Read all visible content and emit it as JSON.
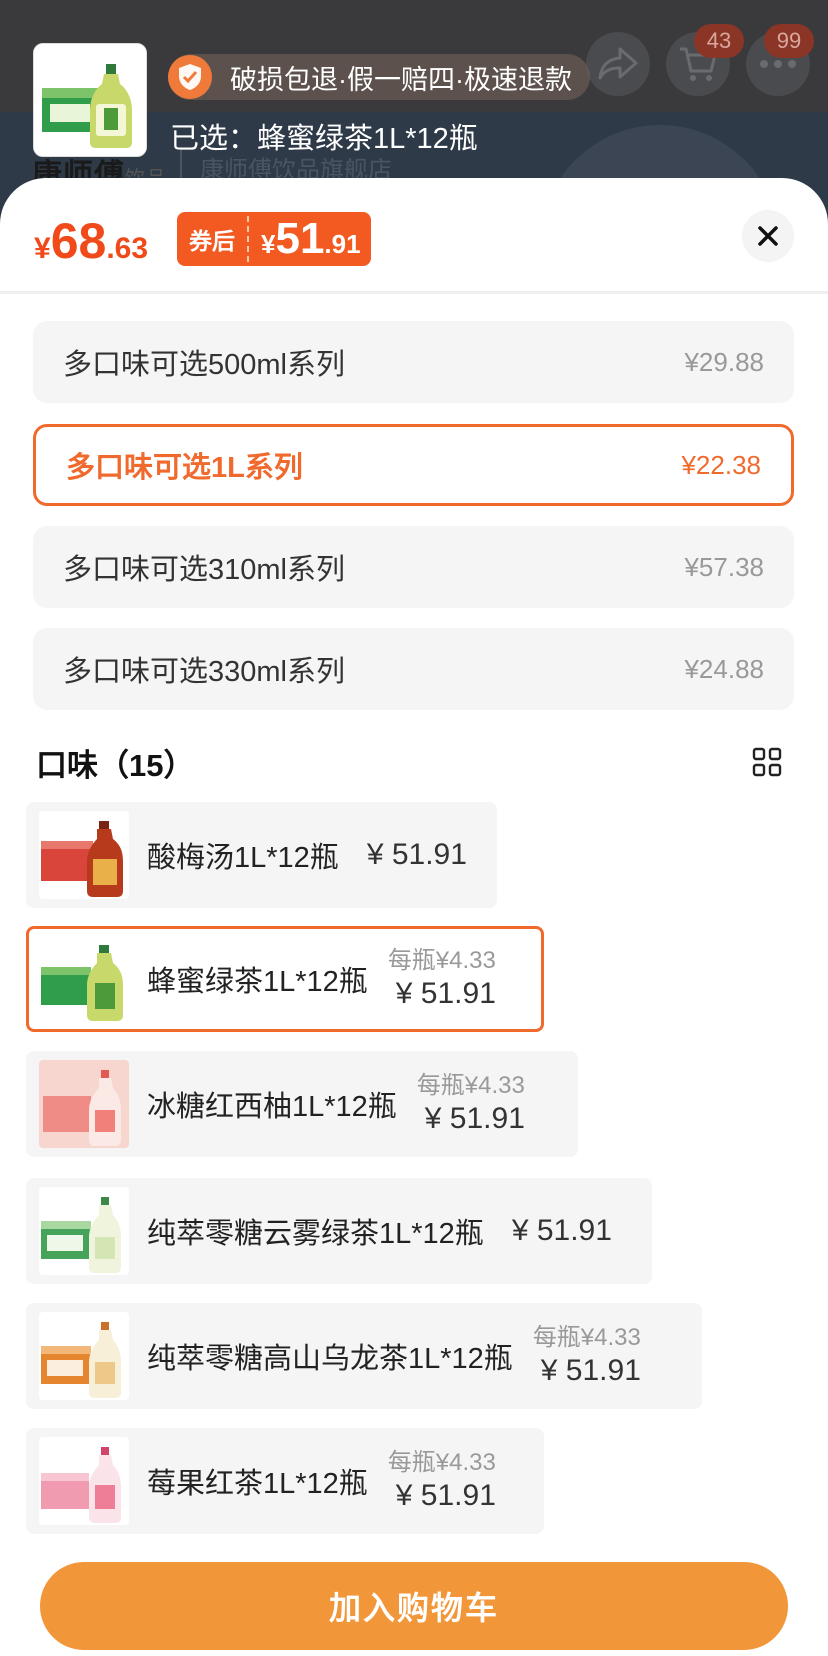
{
  "background": {
    "brand": "康师傅",
    "brand_suffix": "饮品",
    "store_name": "康师傅饮品旗舰店",
    "badge_cart": "43",
    "badge_more": "99"
  },
  "preview": {
    "guarantee_text": "破损包退·假一赔四·极速退款",
    "selected_label": "已选：蜂蜜绿茶1L*12瓶"
  },
  "price": {
    "currency": "¥",
    "int": "68",
    "dec": ".63",
    "coupon_label": "券后",
    "coupon_currency": "¥",
    "coupon_int": "51",
    "coupon_dec": ".91"
  },
  "series": [
    {
      "name": "多口味可选500ml系列",
      "price": "¥29.88",
      "active": false
    },
    {
      "name": "多口味可选1L系列",
      "price": "¥22.38",
      "active": true
    },
    {
      "name": "多口味可选310ml系列",
      "price": "¥57.38",
      "active": false
    },
    {
      "name": "多口味可选330ml系列",
      "price": "¥24.88",
      "active": false
    }
  ],
  "flavor_section": {
    "title": "口味（15）"
  },
  "flavors": [
    {
      "name": "酸梅汤1L*12瓶",
      "per_bottle": "",
      "price": "¥ 51.91",
      "active": false
    },
    {
      "name": "蜂蜜绿茶1L*12瓶",
      "per_bottle": "每瓶¥4.33",
      "price": "¥ 51.91",
      "active": true
    },
    {
      "name": "冰糖红西柚1L*12瓶",
      "per_bottle": "每瓶¥4.33",
      "price": "¥ 51.91",
      "active": false
    },
    {
      "name": "纯萃零糖云雾绿茶1L*12瓶",
      "per_bottle": "",
      "price": "¥ 51.91",
      "active": false
    },
    {
      "name": "纯萃零糖高山乌龙茶1L*12瓶",
      "per_bottle": "每瓶¥4.33",
      "price": "¥ 51.91",
      "active": false
    },
    {
      "name": "莓果红茶1L*12瓶",
      "per_bottle": "每瓶¥4.33",
      "price": "¥ 51.91",
      "active": false
    }
  ],
  "cta": {
    "add_to_cart": "加入购物车"
  },
  "colors": {
    "accent": "#f06a2e",
    "price_red": "#f04a1a",
    "cta": "#f2963a"
  }
}
